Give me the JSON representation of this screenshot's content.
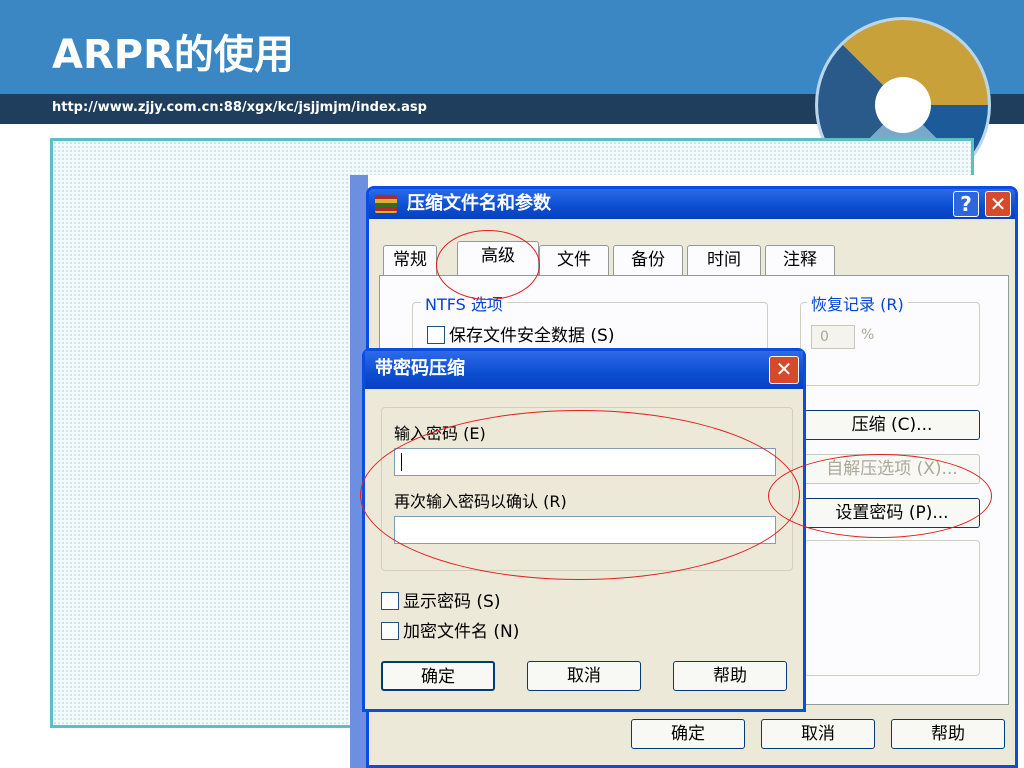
{
  "slide": {
    "title": "ARPR的使用",
    "url": "http://www.zjjy.com.cn:88/xgx/kc/jsjjmjm/index.asp"
  },
  "main_dialog": {
    "title": "压缩文件名和参数",
    "help_btn": "?",
    "close_btn": "✕",
    "tabs": [
      "常规",
      "高级",
      "文件",
      "备份",
      "时间",
      "注释"
    ],
    "ntfs_group": "NTFS 选项",
    "save_security": "保存文件安全数据 (S)",
    "recovery_group": "恢复记录 (R)",
    "recovery_value": "0",
    "recovery_unit": "%",
    "compress_btn": "压缩 (C)...",
    "sfx_btn": "自解压选项 (X)...",
    "set_password_btn": "设置密码 (P)...",
    "ok": "确定",
    "cancel": "取消",
    "help": "帮助"
  },
  "password_dialog": {
    "title": "带密码压缩",
    "close_btn": "✕",
    "enter_password_label": "输入密码 (E)",
    "enter_password_value": "",
    "confirm_password_label": "再次输入密码以确认 (R)",
    "confirm_password_value": "",
    "show_password": "显示密码 (S)",
    "encrypt_filenames": "加密文件名 (N)",
    "ok": "确定",
    "cancel": "取消",
    "help": "帮助"
  },
  "colors": {
    "header": "#3a87c3",
    "url_bar": "#1f3e5e",
    "frame": "#5cc0c2",
    "xp_title": "#0a4ed0",
    "annotation": "#e02020"
  }
}
